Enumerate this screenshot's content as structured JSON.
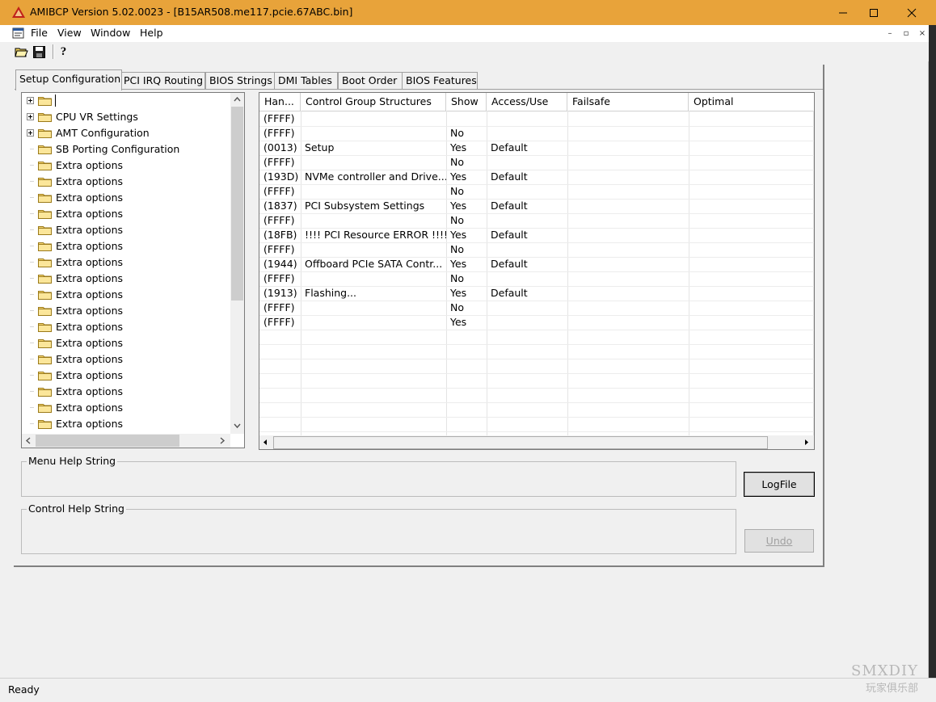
{
  "window": {
    "title": "AMIBCP Version 5.02.0023 - [B15AR508.me117.pcie.67ABC.bin]",
    "controls": {
      "minimize": "—",
      "maximize": "☐",
      "close": "✕"
    }
  },
  "menu": {
    "items": [
      "File",
      "View",
      "Window",
      "Help"
    ],
    "mdi_controls": [
      "–",
      "▫",
      "×"
    ]
  },
  "toolbar": {
    "open_icon": "open-folder-icon",
    "save_icon": "save-disk-icon",
    "help_icon": "help-question-icon",
    "help_glyph": "?"
  },
  "tabs": [
    {
      "label": "Setup Configuration",
      "active": true
    },
    {
      "label": "PCI IRQ Routing",
      "active": false
    },
    {
      "label": "BIOS Strings",
      "active": false
    },
    {
      "label": "DMI Tables",
      "active": false
    },
    {
      "label": "Boot Order",
      "active": false
    },
    {
      "label": "BIOS Features",
      "active": false
    }
  ],
  "tree": {
    "items": [
      {
        "label": "",
        "expandable": true,
        "selected": true
      },
      {
        "label": "CPU VR Settings",
        "expandable": true
      },
      {
        "label": "AMT Configuration",
        "expandable": true
      },
      {
        "label": "SB Porting Configuration",
        "expandable": false
      },
      {
        "label": "Extra options",
        "expandable": false
      },
      {
        "label": "Extra options",
        "expandable": false
      },
      {
        "label": "Extra options",
        "expandable": false
      },
      {
        "label": "Extra options",
        "expandable": false
      },
      {
        "label": "Extra options",
        "expandable": false
      },
      {
        "label": "Extra options",
        "expandable": false
      },
      {
        "label": "Extra options",
        "expandable": false
      },
      {
        "label": "Extra options",
        "expandable": false
      },
      {
        "label": "Extra options",
        "expandable": false
      },
      {
        "label": "Extra options",
        "expandable": false
      },
      {
        "label": "Extra options",
        "expandable": false
      },
      {
        "label": "Extra options",
        "expandable": false
      },
      {
        "label": "Extra options",
        "expandable": false
      },
      {
        "label": "Extra options",
        "expandable": false
      },
      {
        "label": "Extra options",
        "expandable": false
      },
      {
        "label": "Extra options",
        "expandable": false
      },
      {
        "label": "Extra options",
        "expandable": false
      }
    ]
  },
  "grid": {
    "columns": [
      "Han...",
      "Control Group Structures",
      "Show",
      "Access/Use",
      "Failsafe",
      "Optimal"
    ],
    "rows": [
      [
        "(FFFF)",
        "",
        "",
        "",
        "",
        ""
      ],
      [
        "(FFFF)",
        "",
        "No",
        "",
        "",
        ""
      ],
      [
        "(0013)",
        "Setup",
        "Yes",
        "Default",
        "",
        ""
      ],
      [
        "(FFFF)",
        "",
        "No",
        "",
        "",
        ""
      ],
      [
        "(193D)",
        "NVMe controller and Drive...",
        "Yes",
        "Default",
        "",
        ""
      ],
      [
        "(FFFF)",
        "",
        "No",
        "",
        "",
        ""
      ],
      [
        "(1837)",
        "PCI Subsystem Settings",
        "Yes",
        "Default",
        "",
        ""
      ],
      [
        "(FFFF)",
        "",
        "No",
        "",
        "",
        ""
      ],
      [
        "(18FB)",
        "!!!! PCI Resource ERROR !!!!",
        "Yes",
        "Default",
        "",
        ""
      ],
      [
        "(FFFF)",
        "",
        "No",
        "",
        "",
        ""
      ],
      [
        "(1944)",
        "Offboard PCIe SATA Contr...",
        "Yes",
        "Default",
        "",
        ""
      ],
      [
        "(FFFF)",
        "",
        "No",
        "",
        "",
        ""
      ],
      [
        "(1913)",
        "Flashing...",
        "Yes",
        "Default",
        "",
        ""
      ],
      [
        "(FFFF)",
        "",
        "No",
        "",
        "",
        ""
      ],
      [
        "(FFFF)",
        "",
        "Yes",
        "",
        "",
        ""
      ]
    ]
  },
  "help": {
    "menu_help_label": "Menu Help String",
    "control_help_label": "Control Help String"
  },
  "buttons": {
    "logfile": "LogFile",
    "undo": "Undo"
  },
  "status": {
    "text": "Ready"
  },
  "watermark": {
    "line1": "SMXDIY",
    "line2": "玩家俱乐部"
  }
}
